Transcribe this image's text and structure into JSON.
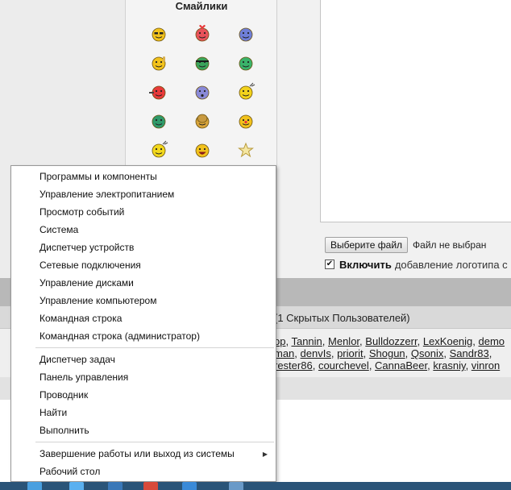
{
  "smileys": {
    "title": "Смайлики",
    "items": [
      {
        "icon": "cool-sunglasses-smiley-icon"
      },
      {
        "icon": "in-love-smiley-icon"
      },
      {
        "icon": "crying-smiley-icon"
      },
      {
        "icon": "thumbs-up-smiley-icon"
      },
      {
        "icon": "ninja-smiley-icon"
      },
      {
        "icon": "green-ok-smiley-icon"
      },
      {
        "icon": "shooting-smiley-icon"
      },
      {
        "icon": "blue-surprised-smiley-icon"
      },
      {
        "icon": "partying-smiley-icon"
      },
      {
        "icon": "green-shy-smiley-icon"
      },
      {
        "icon": "clapping-hands-smiley-icon"
      },
      {
        "icon": "clown-smiley-icon"
      },
      {
        "icon": "cheering-smiley-icon"
      },
      {
        "icon": "laughing-smiley-icon"
      },
      {
        "icon": "star-smiley-icon"
      }
    ]
  },
  "attachment": {
    "choose_file_label": "Выберите файл",
    "no_file_text": "Файл не выбран"
  },
  "logo_option": {
    "bold_label": "Включить",
    "rest_label": "добавление логотипа с"
  },
  "online_users": {
    "header": "(1 Скрытых Пользователей)",
    "rows": [
      [
        {
          "text": "op",
          "link": true
        },
        {
          "text": ", ",
          "link": false
        },
        {
          "text": "Tannin",
          "link": true
        },
        {
          "text": ", ",
          "link": false
        },
        {
          "text": "Menlor",
          "link": true
        },
        {
          "text": ", ",
          "link": false
        },
        {
          "text": "Bulldozzerr",
          "link": true
        },
        {
          "text": ", ",
          "link": false
        },
        {
          "text": "LexKoenig",
          "link": true
        },
        {
          "text": ", ",
          "link": false
        },
        {
          "text": "demo",
          "link": true
        }
      ],
      [
        {
          "text": "man",
          "link": true
        },
        {
          "text": ", ",
          "link": false
        },
        {
          "text": "denvIs",
          "link": true
        },
        {
          "text": ", ",
          "link": false
        },
        {
          "text": "priorit",
          "link": true
        },
        {
          "text": ", ",
          "link": false
        },
        {
          "text": "Shogun",
          "link": true
        },
        {
          "text": ", ",
          "link": false
        },
        {
          "text": "Qsonix",
          "link": true
        },
        {
          "text": ", ",
          "link": false
        },
        {
          "text": "Sandr83",
          "link": true
        },
        {
          "text": ", ",
          "link": false
        }
      ],
      [
        {
          "text": "rester86",
          "link": true
        },
        {
          "text": ", ",
          "link": false
        },
        {
          "text": "courchevel",
          "link": true
        },
        {
          "text": ", ",
          "link": false
        },
        {
          "text": "CannaBeer",
          "link": true
        },
        {
          "text": ", ",
          "link": false
        },
        {
          "text": "krasniy",
          "link": true
        },
        {
          "text": ", ",
          "link": false
        },
        {
          "text": "vinron",
          "link": true
        }
      ]
    ]
  },
  "context_menu": {
    "groups": [
      [
        {
          "label": "Программы и компоненты"
        },
        {
          "label": "Управление электропитанием"
        },
        {
          "label": "Просмотр событий"
        },
        {
          "label": "Система"
        },
        {
          "label": "Диспетчер устройств"
        },
        {
          "label": "Сетевые подключения"
        },
        {
          "label": "Управление дисками"
        },
        {
          "label": "Управление компьютером"
        },
        {
          "label": "Командная строка"
        },
        {
          "label": "Командная строка (администратор)"
        }
      ],
      [
        {
          "label": "Диспетчер задач"
        },
        {
          "label": "Панель управления"
        },
        {
          "label": "Проводник"
        },
        {
          "label": "Найти"
        },
        {
          "label": "Выполнить"
        }
      ],
      [
        {
          "label": "Завершение работы или выход из системы",
          "submenu": true
        },
        {
          "label": "Рабочий стол"
        }
      ]
    ]
  },
  "taskbar": {
    "start_icon": "windows-logo-icon",
    "app_icons": [
      "app-icon-1",
      "app-icon-2",
      "app-icon-3",
      "chrome-icon",
      "app-icon-5",
      "app-icon-6"
    ]
  }
}
